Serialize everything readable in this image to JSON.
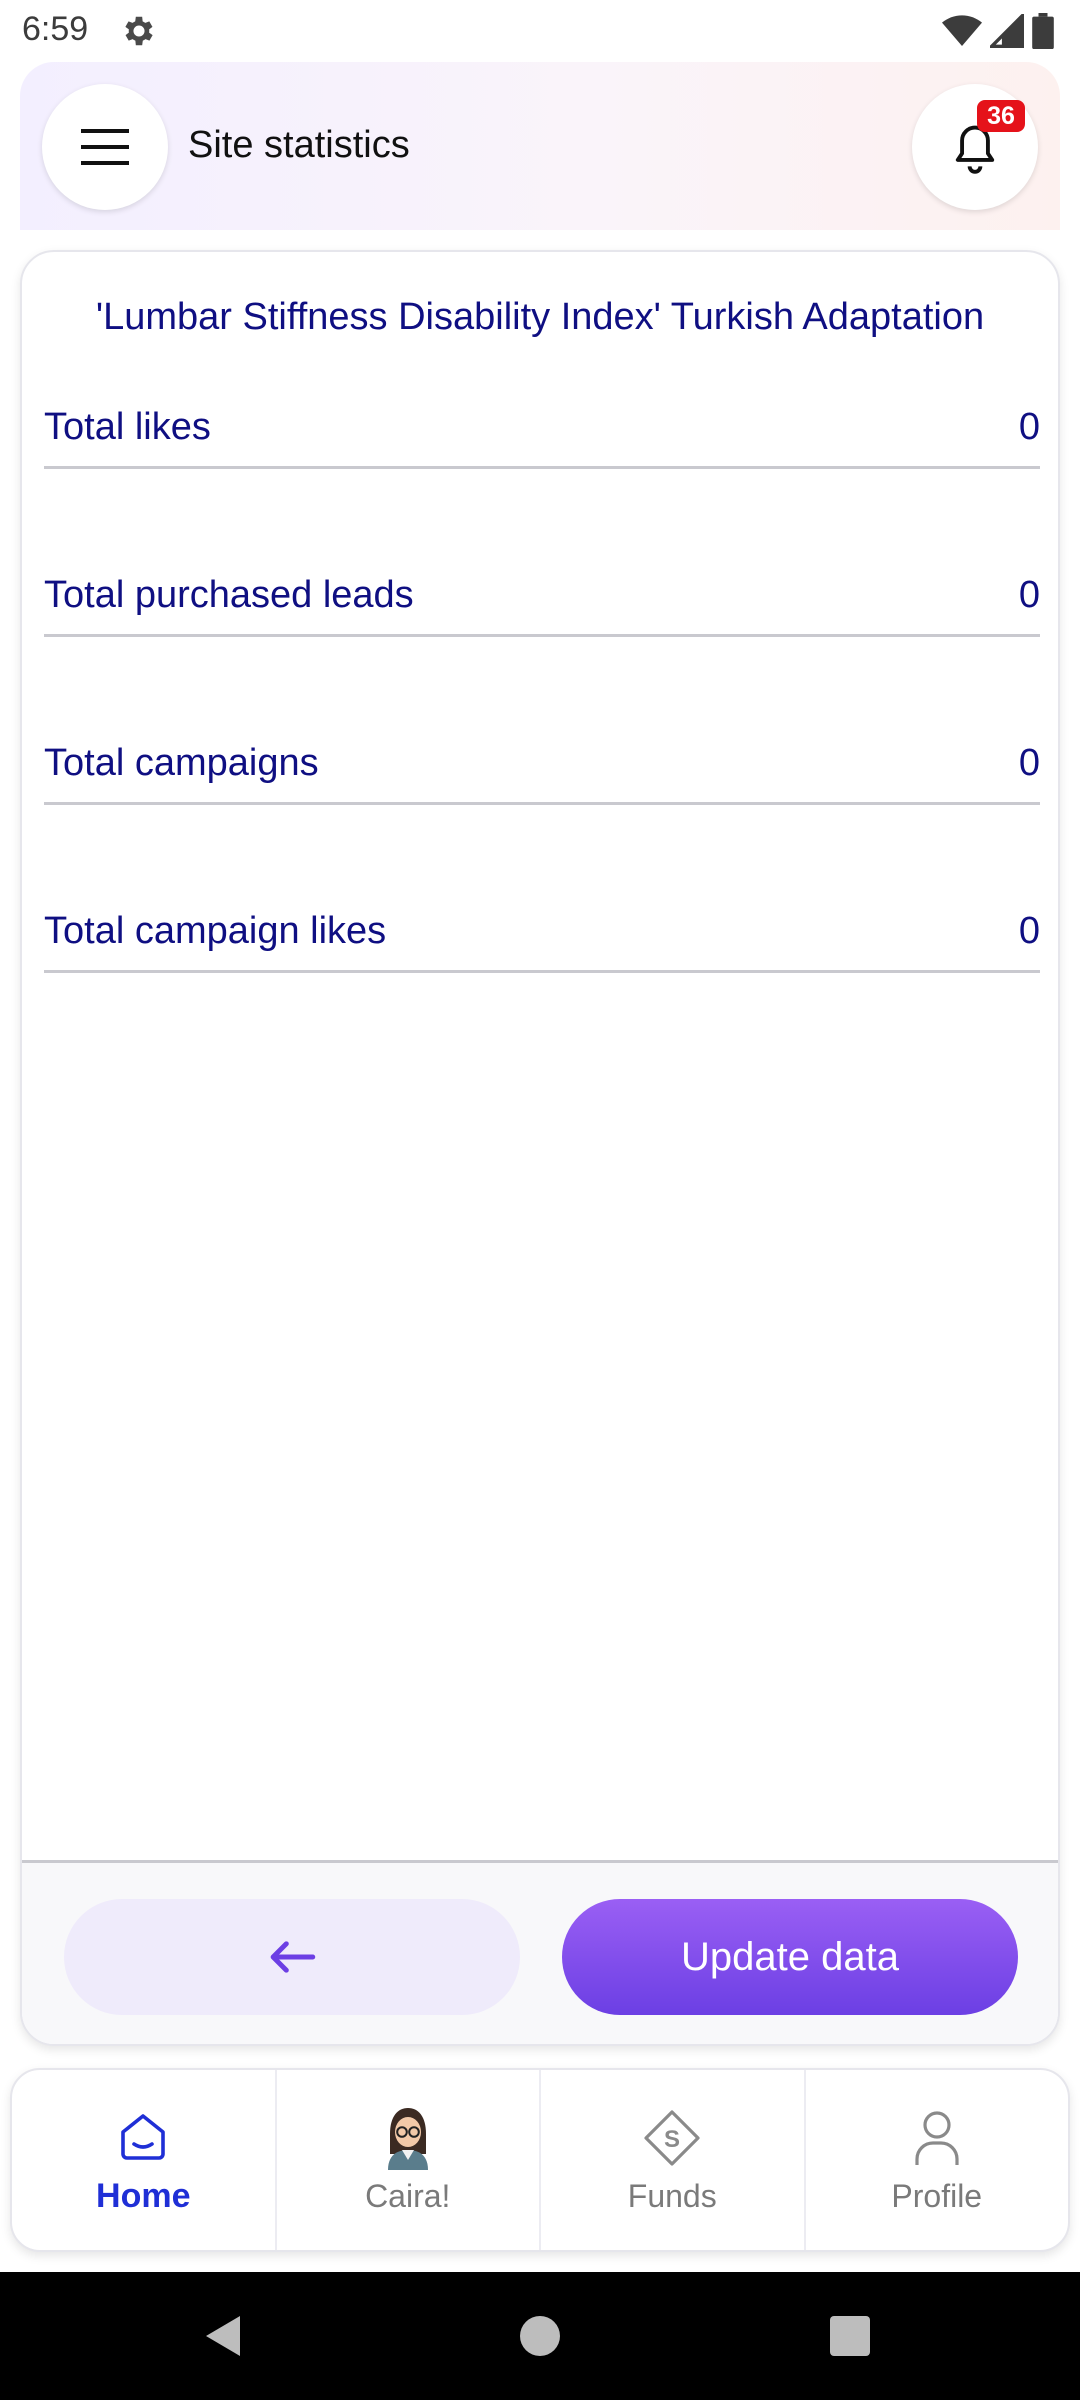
{
  "status_bar": {
    "time": "6:59",
    "icons": [
      "gear-icon",
      "wifi-icon",
      "signal-icon",
      "battery-icon"
    ]
  },
  "header": {
    "title": "Site statistics",
    "notification_count": "36",
    "icons": [
      "hamburger-menu-icon",
      "bell-icon"
    ]
  },
  "card": {
    "title": "'Lumbar Stiffness Disability Index' Turkish Adaptation",
    "stats": [
      {
        "label": "Total likes",
        "value": "0"
      },
      {
        "label": "Total purchased leads",
        "value": "0"
      },
      {
        "label": "Total campaigns",
        "value": "0"
      },
      {
        "label": "Total campaign likes",
        "value": "0"
      }
    ],
    "update_button": "Update data",
    "back_icon": "arrow-left-icon"
  },
  "bottom_nav": {
    "items": [
      {
        "label": "Home",
        "icon": "home-icon",
        "active": true
      },
      {
        "label": "Caira!",
        "icon": "avatar-icon",
        "active": false
      },
      {
        "label": "Funds",
        "icon": "funds-icon",
        "active": false
      },
      {
        "label": "Profile",
        "icon": "profile-icon",
        "active": false
      }
    ]
  },
  "colors": {
    "primary_text": "#0f0f82",
    "accent_purple": "#7b47ec",
    "active_nav": "#1f2fd6",
    "badge_red": "#e5121a"
  }
}
